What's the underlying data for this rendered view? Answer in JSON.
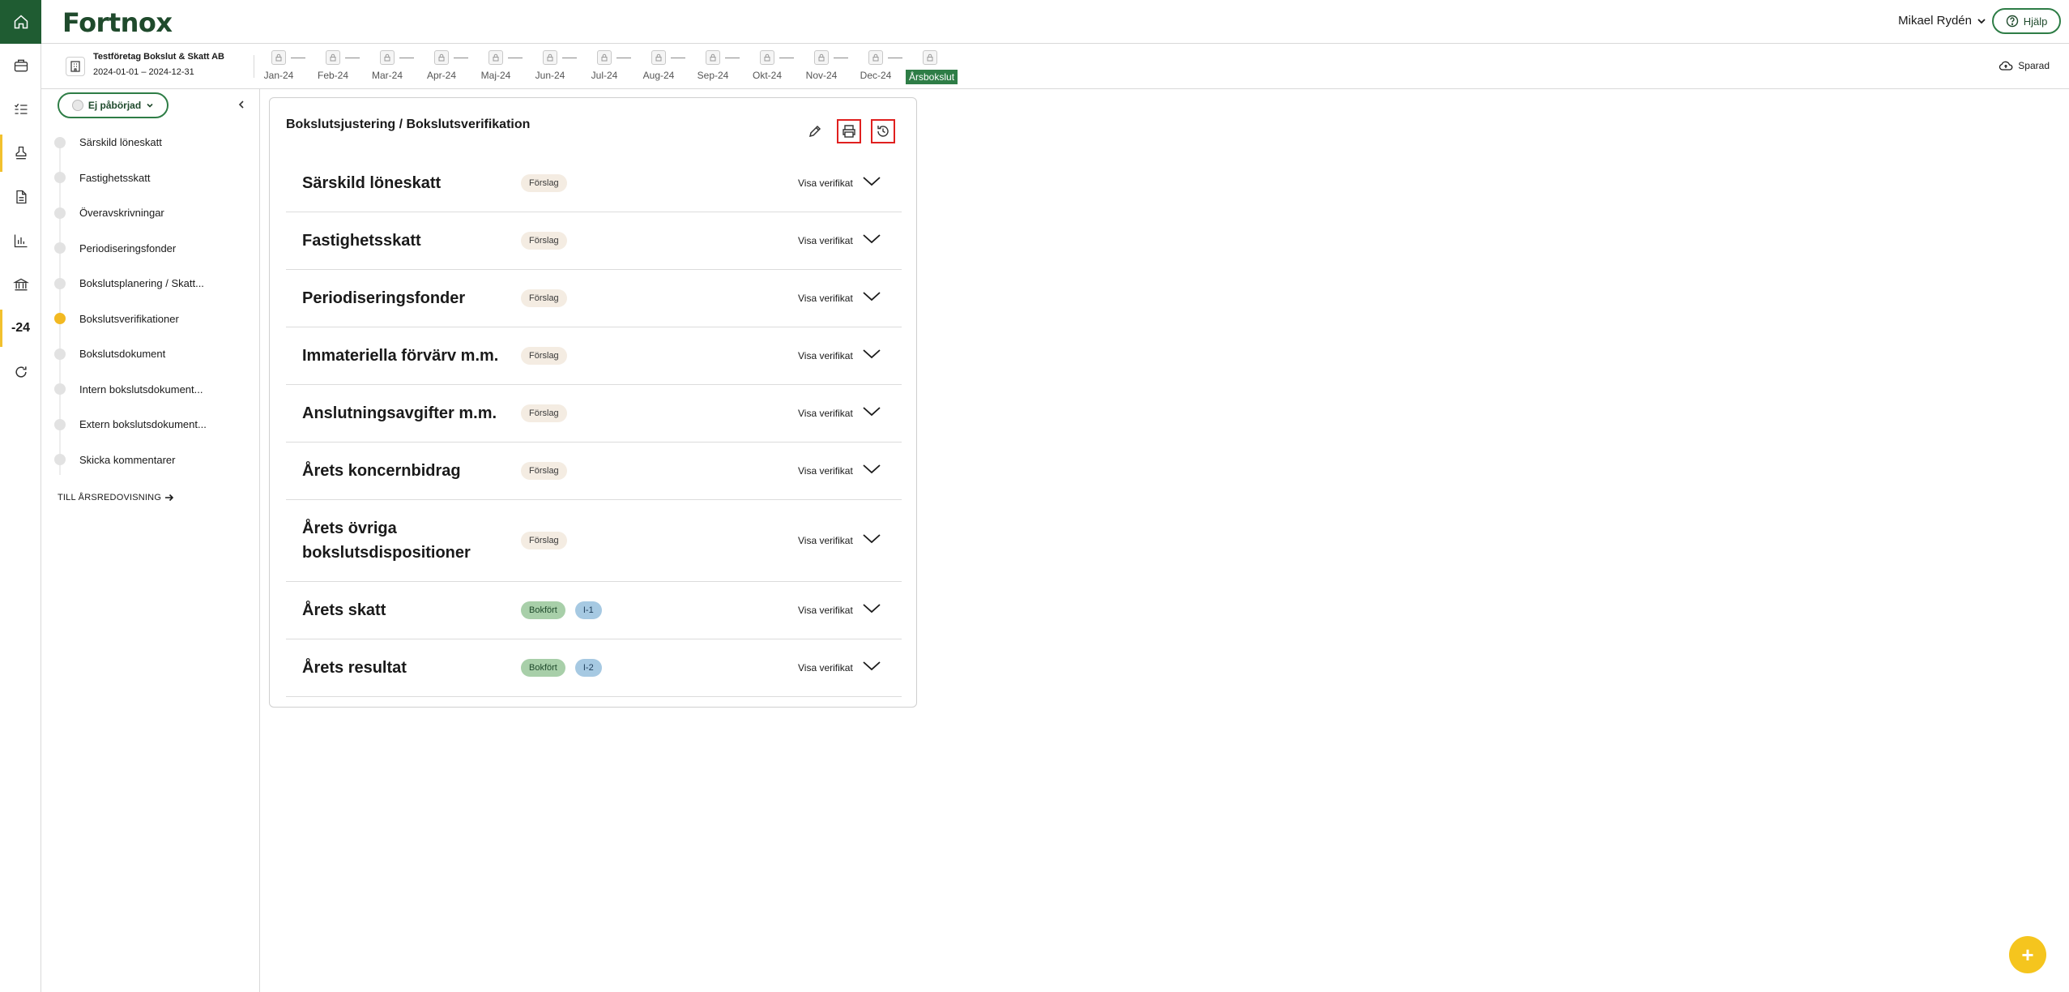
{
  "app": {
    "logo": "Fortnox"
  },
  "header": {
    "user_name": "Mikael Rydén",
    "help_label": "Hjälp"
  },
  "rail": {
    "icons": [
      "home-icon",
      "briefcase-icon",
      "checklist-icon",
      "stamp-icon",
      "document-icon",
      "chart-icon",
      "bank-icon",
      "year-indicator",
      "refresh-icon"
    ],
    "year_label": "-24",
    "colors": {
      "home_bg": "#1f5c32",
      "active_marker": "#f2c12e"
    }
  },
  "company": {
    "name": "Testföretag Bokslut & Skatt AB",
    "period": "2024-01-01 – 2024-12-31"
  },
  "timeline": {
    "months": [
      "Jan-24",
      "Feb-24",
      "Mar-24",
      "Apr-24",
      "Maj-24",
      "Jun-24",
      "Jul-24",
      "Aug-24",
      "Sep-24",
      "Okt-24",
      "Nov-24",
      "Dec-24",
      "Årsbokslut"
    ],
    "active": "Årsbokslut"
  },
  "save_status": "Sparad",
  "leftnav": {
    "status_label": "Ej påbörjad",
    "items": [
      {
        "label": "Särskild löneskatt"
      },
      {
        "label": "Fastighetsskatt"
      },
      {
        "label": "Överavskrivningar"
      },
      {
        "label": "Periodiseringsfonder"
      },
      {
        "label": "Bokslutsplanering / Skatt..."
      },
      {
        "label": "Bokslutsverifikationer"
      },
      {
        "label": "Bokslutsdokument"
      },
      {
        "label": "Intern bokslutsdokument..."
      },
      {
        "label": "Extern bokslutsdokument..."
      },
      {
        "label": "Skicka kommentarer"
      }
    ],
    "current_index": 5,
    "to_annual_label": "TILL ÅRSREDOVISNING"
  },
  "card": {
    "title": "Bokslutsjustering / Bokslutsverifikation",
    "action_icons": [
      "edit-icon",
      "print-icon",
      "history-icon"
    ],
    "visa_label": "Visa verifikat",
    "rows": [
      {
        "title": "Särskild löneskatt",
        "status": "Förslag",
        "verification": ""
      },
      {
        "title": "Fastighetsskatt",
        "status": "Förslag",
        "verification": ""
      },
      {
        "title": "Periodiseringsfonder",
        "status": "Förslag",
        "verification": ""
      },
      {
        "title": "Immateriella förvärv m.m.",
        "status": "Förslag",
        "verification": ""
      },
      {
        "title": "Anslutningsavgifter m.m.",
        "status": "Förslag",
        "verification": ""
      },
      {
        "title": "Årets koncernbidrag",
        "status": "Förslag",
        "verification": ""
      },
      {
        "title": "Årets övriga bokslutsdispositioner",
        "status": "Förslag",
        "verification": ""
      },
      {
        "title": "Årets skatt",
        "status": "Bokfört",
        "verification": "I-1"
      },
      {
        "title": "Årets resultat",
        "status": "Bokfört",
        "verification": "I-2"
      }
    ]
  },
  "fab": {
    "label": "+",
    "color": "#f5c51e"
  }
}
